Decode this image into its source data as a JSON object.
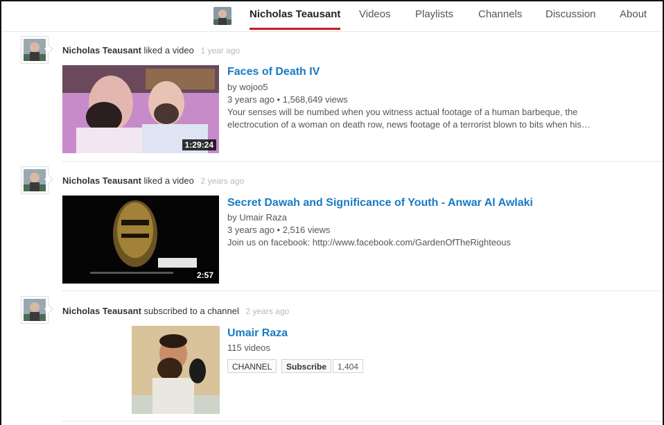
{
  "header": {
    "tabs": [
      {
        "label": "Nicholas Teausant",
        "active": true
      },
      {
        "label": "Videos",
        "active": false
      },
      {
        "label": "Playlists",
        "active": false
      },
      {
        "label": "Channels",
        "active": false
      },
      {
        "label": "Discussion",
        "active": false
      },
      {
        "label": "About",
        "active": false
      }
    ]
  },
  "feed": [
    {
      "actor": "Nicholas Teausant",
      "action": "liked a video",
      "ago": "1 year ago",
      "video": {
        "title": "Faces of Death IV",
        "by": "by wojoo5",
        "stats": "3 years ago • 1,568,649 views",
        "description": "Your senses will be numbed when you witness actual footage of a human barbeque, the electrocution of a woman on death row, news footage of a terrorist blown to bits when his…",
        "duration": "1:29:24"
      }
    },
    {
      "actor": "Nicholas Teausant",
      "action": "liked a video",
      "ago": "2 years ago",
      "video": {
        "title": "Secret Dawah and Significance of Youth - Anwar Al Awlaki",
        "by": "by Umair Raza",
        "stats": "3 years ago • 2,516 views",
        "description": "Join us on facebook: http://www.facebook.com/GardenOfTheRighteous",
        "duration": "2:57"
      }
    },
    {
      "actor": "Nicholas Teausant",
      "action": "subscribed to a channel",
      "ago": "2 years ago",
      "channel": {
        "name": "Umair Raza",
        "video_count": "115 videos",
        "channel_label": "CHANNEL",
        "subscribe_label": "Subscribe",
        "subscriber_count": "1,404"
      }
    }
  ],
  "colors": {
    "link": "#167ac6",
    "active_tab_underline": "#cc181e"
  }
}
